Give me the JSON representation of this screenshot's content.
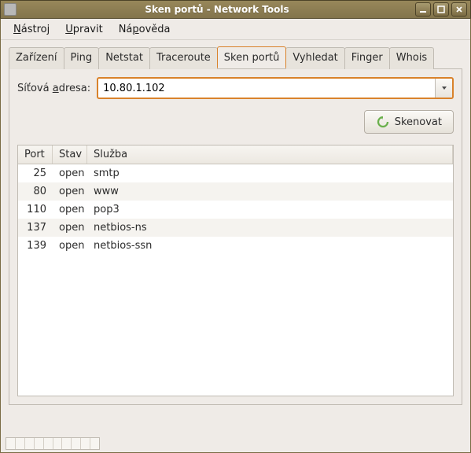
{
  "window": {
    "title": "Sken portů - Network Tools"
  },
  "menu": {
    "nastroj": {
      "label": "Nástroj",
      "underline_at": 0
    },
    "upravit": {
      "label": "Upravit",
      "underline_at": 0
    },
    "napoveda": {
      "label": "Nápověda",
      "underline_at": 2
    }
  },
  "tabs": {
    "items": [
      {
        "label": "Zařízení"
      },
      {
        "label": "Ping"
      },
      {
        "label": "Netstat"
      },
      {
        "label": "Traceroute"
      },
      {
        "label": "Sken portů",
        "active": true
      },
      {
        "label": "Vyhledat"
      },
      {
        "label": "Finger"
      },
      {
        "label": "Whois"
      }
    ]
  },
  "address": {
    "label_prefix": "Síťová ",
    "label_u": "a",
    "label_suffix": "dresa:",
    "value": "10.80.1.102"
  },
  "buttons": {
    "scan": "Skenovat"
  },
  "table": {
    "headers": {
      "port": "Port",
      "stav": "Stav",
      "sluzba": "Služba"
    },
    "rows": [
      {
        "port": "25",
        "stav": "open",
        "sluzba": "smtp"
      },
      {
        "port": "80",
        "stav": "open",
        "sluzba": "www"
      },
      {
        "port": "110",
        "stav": "open",
        "sluzba": "pop3"
      },
      {
        "port": "137",
        "stav": "open",
        "sluzba": "netbios-ns"
      },
      {
        "port": "139",
        "stav": "open",
        "sluzba": "netbios-ssn"
      }
    ]
  }
}
